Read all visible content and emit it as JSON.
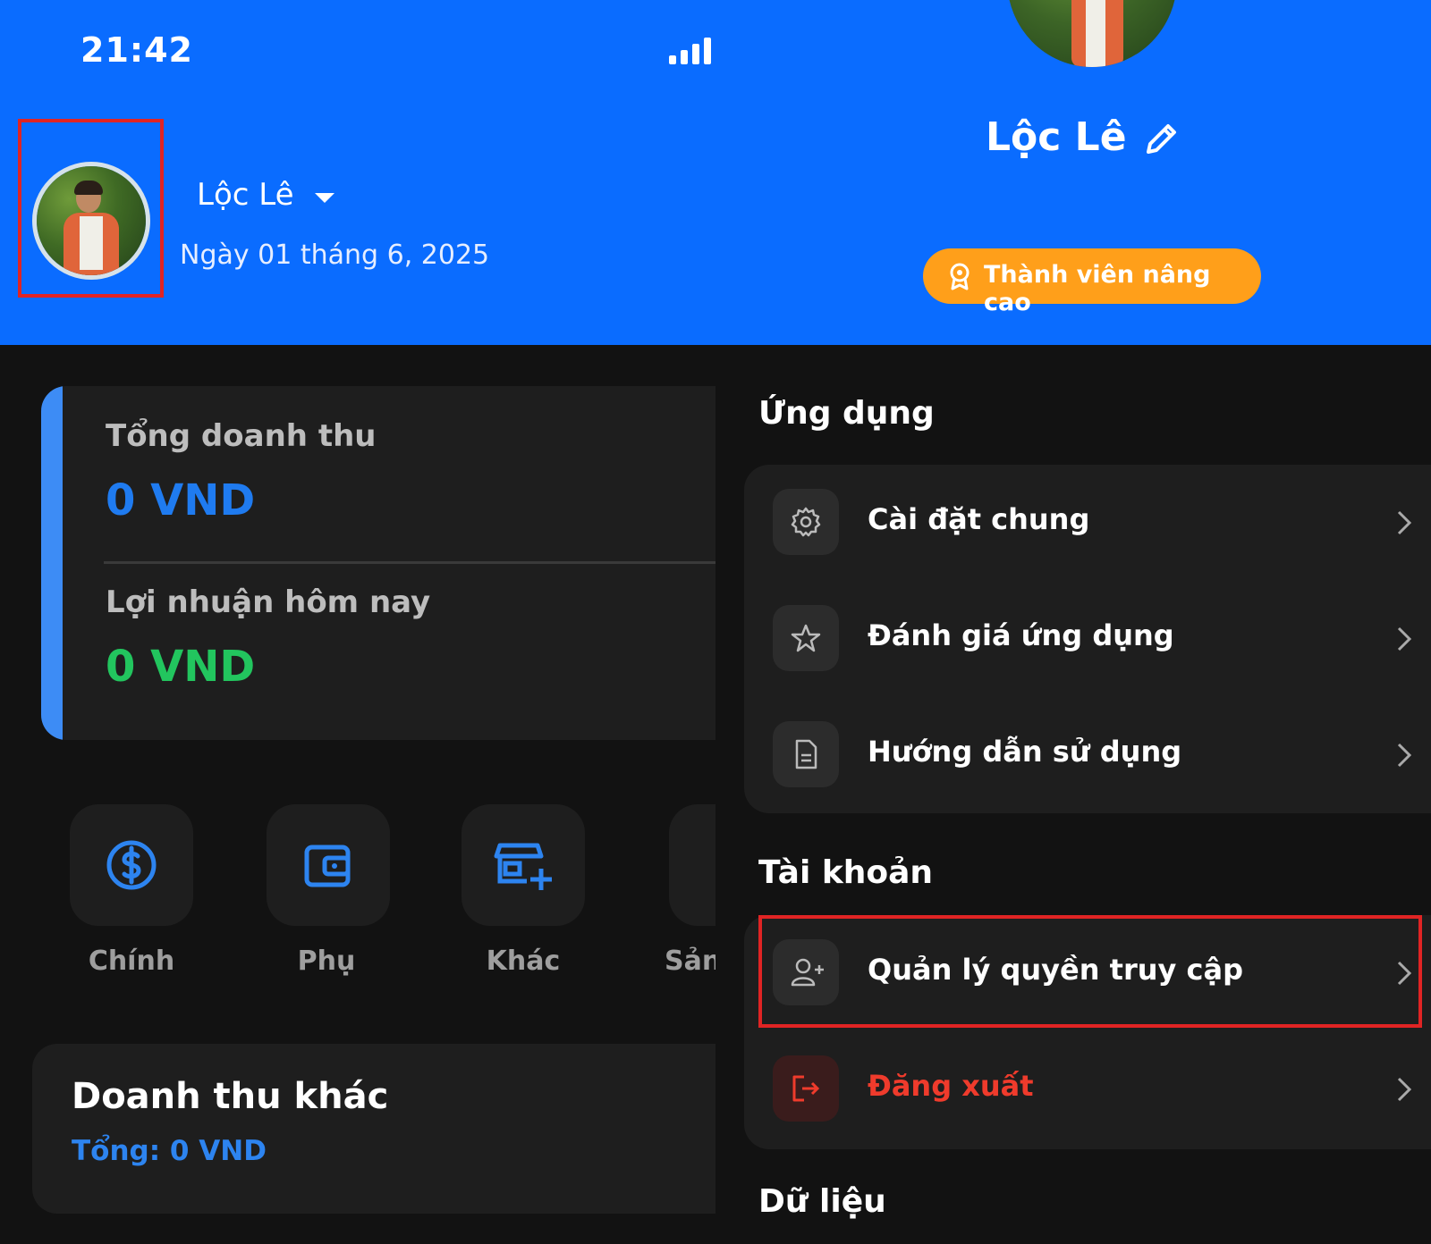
{
  "status_bar": {
    "time": "21:42"
  },
  "header": {
    "user_name": "Lộc Lê",
    "date": "Ngày 01 tháng 6, 2025"
  },
  "stats": {
    "revenue_label": "Tổng doanh thu",
    "revenue_value": "0 VND",
    "profit_label": "Lợi nhuận hôm nay",
    "profit_value": "0 VND"
  },
  "quick_actions": [
    {
      "label": "Chính",
      "icon": "dollar-circle-icon"
    },
    {
      "label": "Phụ",
      "icon": "wallet-icon"
    },
    {
      "label": "Khác",
      "icon": "store-add-icon"
    },
    {
      "label": "Sản",
      "icon": "box-icon"
    }
  ],
  "other_revenue": {
    "title": "Doanh thu khác",
    "total": "Tổng: 0 VND"
  },
  "profile": {
    "name": "Lộc Lê",
    "membership": "Thành viên nâng cao"
  },
  "sections": {
    "app": {
      "title": "Ứng dụng",
      "items": [
        {
          "label": "Cài đặt chung",
          "icon": "gear-icon"
        },
        {
          "label": "Đánh giá ứng dụng",
          "icon": "star-icon"
        },
        {
          "label": "Hướng dẫn sử dụng",
          "icon": "document-icon"
        }
      ]
    },
    "account": {
      "title": "Tài khoản",
      "items": [
        {
          "label": "Quản lý quyền truy cập",
          "icon": "user-add-icon"
        },
        {
          "label": "Đăng xuất",
          "icon": "logout-icon"
        }
      ]
    },
    "data": {
      "title": "Dữ liệu"
    }
  },
  "colors": {
    "header_blue": "#0a6cff",
    "revenue_blue": "#1f7bf0",
    "profit_green": "#22c55e",
    "membership_orange": "#ff9f1a",
    "logout_red": "#ef3b2c",
    "highlight_red": "#e02424"
  }
}
